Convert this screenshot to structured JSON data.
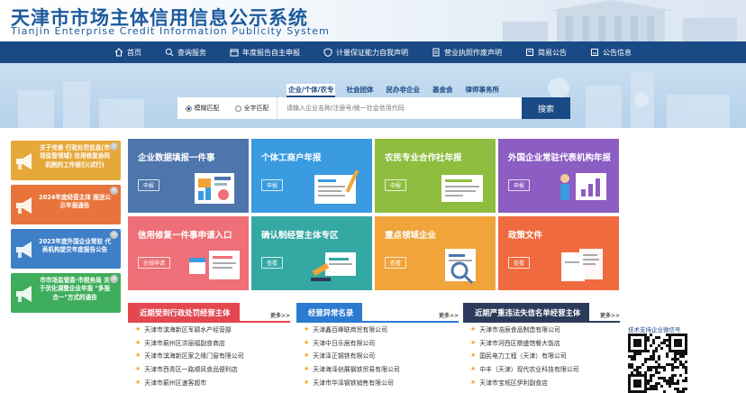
{
  "header": {
    "title_cn": "天津市市场主体信用信息公示系统",
    "title_en": "Tianjin Enterprise Credit Information Publicity System"
  },
  "nav": [
    {
      "label": "首页",
      "icon": "home-icon"
    },
    {
      "label": "查询服务",
      "icon": "search-icon"
    },
    {
      "label": "年度报告自主申报",
      "icon": "calendar-icon"
    },
    {
      "label": "计量保证能力自我声明",
      "icon": "shield-icon"
    },
    {
      "label": "营业执照作废声明",
      "icon": "document-icon"
    },
    {
      "label": "简易公告",
      "icon": "notice-icon"
    },
    {
      "label": "公告信息",
      "icon": "info-icon"
    }
  ],
  "search": {
    "tabs": [
      "企业/个体/农专",
      "社会团体",
      "民办非企业",
      "基金会",
      "律师事务所"
    ],
    "active_tab": 0,
    "mode_fuzzy": "模糊匹配",
    "mode_exact": "全字匹配",
    "placeholder": "请输入企业名称/注册号/统一社会信用代码",
    "button": "搜索"
  },
  "notices": [
    {
      "text": "关于完善 行政处罚信息(市场监管领域) 信用修复协同机制的工作规引(试行)",
      "bg": "#e7a83a"
    },
    {
      "text": "2024年度经营主体 报送公示年报通告",
      "bg": "#e9743b"
    },
    {
      "text": "2023年度外国企业常驻 代表机构提交年度报告公告",
      "bg": "#3e80c8"
    },
    {
      "text": "市市场监管委·市税务局 关于优化调整企业年报 \"多报合一\"方式的通告",
      "bg": "#3fae5c"
    }
  ],
  "tiles": [
    {
      "title": "企业数据填报一件事",
      "button": "申报",
      "color": "#4e76ad"
    },
    {
      "title": "个体工商户年报",
      "button": "申报",
      "color": "#3a9be0"
    },
    {
      "title": "农民专业合作社年报",
      "button": "申报",
      "color": "#8fbd3f"
    },
    {
      "title": "外国企业常驻代表机构年报",
      "button": "申报",
      "color": "#8c5dc3"
    },
    {
      "title": "信用修复一件事申请入口",
      "button": "在线申请",
      "color": "#ee6f77"
    },
    {
      "title": "确认制经营主体专区",
      "button": "查看",
      "color": "#34a8a3"
    },
    {
      "title": "重点领域企业",
      "button": "查看",
      "color": "#f0a43a"
    },
    {
      "title": "政策文件",
      "button": "查看",
      "color": "#f06a3f"
    }
  ],
  "lists": [
    {
      "title": "近期受到行政处罚经营主体",
      "more": "更多>>",
      "color": "#e3474f",
      "items": [
        "天津市滨海新区军颖水产经营部",
        "天津市蓟州区洪丽福副食商店",
        "天津市滨海新区家之缘门窗有限公司",
        "天津市西青区一路顺风食品便利店",
        "天津市蓟州区速客超市"
      ]
    },
    {
      "title": "经营异常名录",
      "more": "更多>>",
      "color": "#2b7bd1",
      "items": [
        "天津鑫百峰联商贸有限公司",
        "天津中日乐居有限公司",
        "天津泽正钢铁有限公司",
        "天津海泽创展钢铁贸易有限公司",
        "天津市华泽钢铁销售有限公司"
      ]
    },
    {
      "title": "近期严重违法失信名单经营主体",
      "more": "更多>>",
      "color": "#2d3a5b",
      "items": [
        "天津市浩辰食品制造有限公司",
        "天津市河西区鼎盛馆餐大饭店",
        "国民电力工程（天津）有限公司",
        "中丰（天津）现代农业科技有限公司",
        "天津市宝坻区伊利副食店"
      ]
    }
  ],
  "qr": {
    "label": "技术支持企业微信号"
  }
}
